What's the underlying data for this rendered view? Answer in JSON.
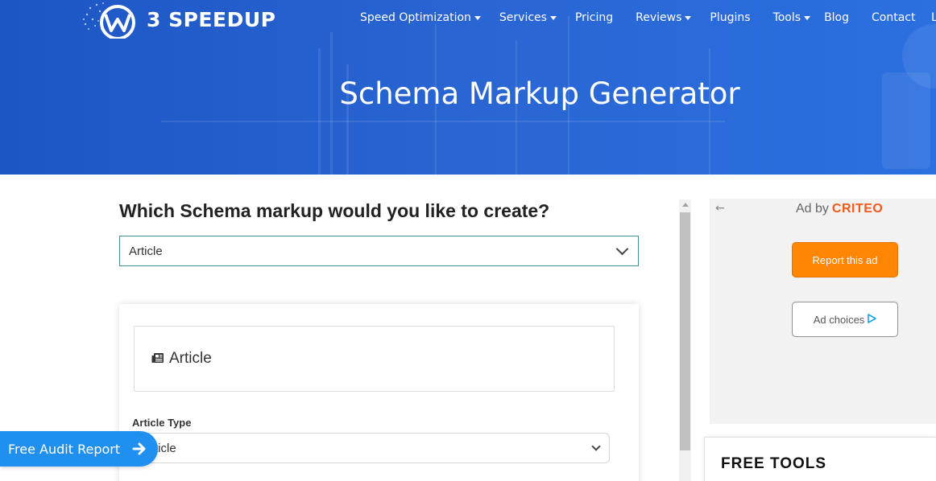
{
  "header": {
    "logo_text": "3 SPEEDUP",
    "nav": [
      {
        "label": "Speed Optimization",
        "dropdown": true
      },
      {
        "label": "Services",
        "dropdown": true
      },
      {
        "label": "Pricing",
        "dropdown": false
      },
      {
        "label": "Reviews",
        "dropdown": true
      },
      {
        "label": "Plugins",
        "dropdown": false
      },
      {
        "label": "Tools",
        "dropdown": true
      },
      {
        "label": "Blog",
        "dropdown": false
      },
      {
        "label": "Contact",
        "dropdown": false
      }
    ],
    "nav_cut": "L",
    "page_title": "Schema Markup Generator",
    "colors": {
      "hero": "#2a66d4"
    }
  },
  "main": {
    "question": "Which Schema markup would you like to create?",
    "schema_select_value": "Article",
    "card": {
      "title": "Article",
      "icon": "newspaper-icon",
      "article_type_label": "Article Type",
      "article_type_value": "Article"
    }
  },
  "audit_button": {
    "label": "Free Audit Report",
    "icon": "arrow-right-icon"
  },
  "ad": {
    "back_icon": "arrow-left-icon",
    "ad_by": "Ad by",
    "brand": "CRITEO",
    "report_label": "Report this ad",
    "choices_label": "Ad choices",
    "colors": {
      "report": "#fe8602",
      "brand": "#f25a1d",
      "choices_icon": "#1aa6e0"
    }
  },
  "sidebar": {
    "tools_title": "FREE TOOLS"
  }
}
